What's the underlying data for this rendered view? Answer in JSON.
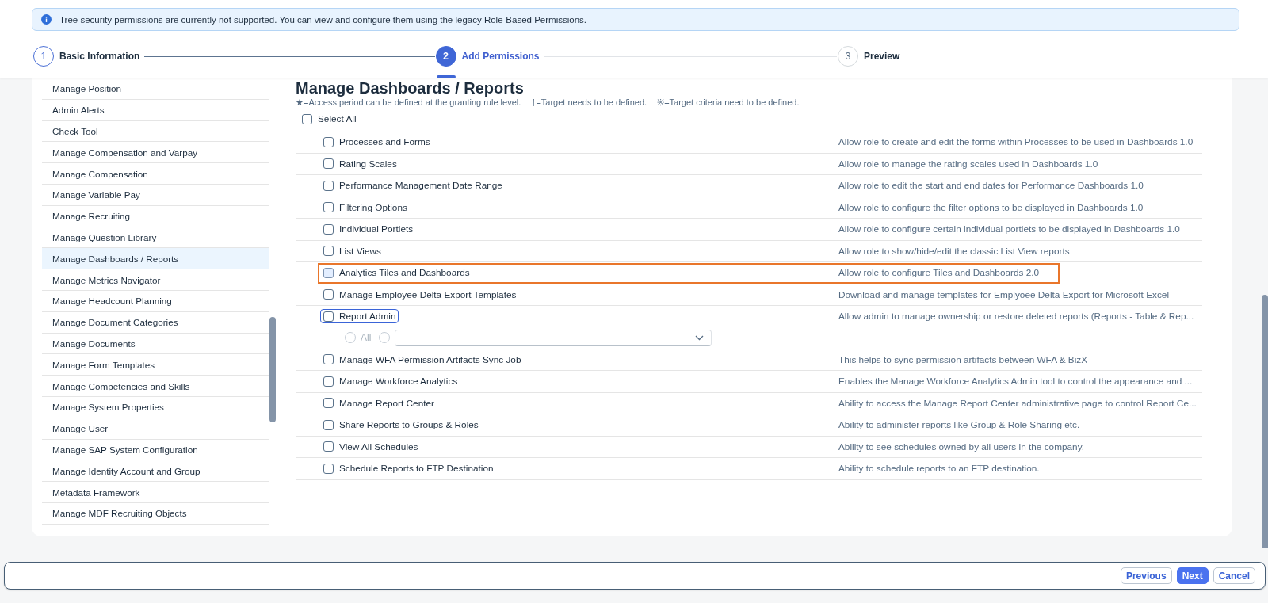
{
  "banner": {
    "kind": "info",
    "text": "Tree security permissions are currently not supported. You can view and configure them using the legacy Role-Based Permissions."
  },
  "steps": [
    {
      "number": "1",
      "label": "Basic Information",
      "selected": false,
      "completed": true
    },
    {
      "number": "2",
      "label": "Add Permissions",
      "selected": true,
      "completed": false
    },
    {
      "number": "3",
      "label": "Preview",
      "selected": false,
      "completed": false
    }
  ],
  "sidebar": {
    "items": [
      {
        "label": "Manage Position",
        "selected": false
      },
      {
        "label": "Admin Alerts",
        "selected": false
      },
      {
        "label": "Check Tool",
        "selected": false
      },
      {
        "label": "Manage Compensation and Varpay",
        "selected": false
      },
      {
        "label": "Manage Compensation",
        "selected": false
      },
      {
        "label": "Manage Variable Pay",
        "selected": false
      },
      {
        "label": "Manage Recruiting",
        "selected": false
      },
      {
        "label": "Manage Question Library",
        "selected": false
      },
      {
        "label": "Manage Dashboards / Reports",
        "selected": true
      },
      {
        "label": "Manage Metrics Navigator",
        "selected": false
      },
      {
        "label": "Manage Headcount Planning",
        "selected": false
      },
      {
        "label": "Manage Document Categories",
        "selected": false
      },
      {
        "label": "Manage Documents",
        "selected": false
      },
      {
        "label": "Manage Form Templates",
        "selected": false
      },
      {
        "label": "Manage Competencies and Skills",
        "selected": false
      },
      {
        "label": "Manage System Properties",
        "selected": false
      },
      {
        "label": "Manage User",
        "selected": false
      },
      {
        "label": "Manage SAP System Configuration",
        "selected": false
      },
      {
        "label": "Manage Identity Account and Group",
        "selected": false
      },
      {
        "label": "Metadata Framework",
        "selected": false
      },
      {
        "label": "Manage MDF Recruiting Objects",
        "selected": false
      }
    ]
  },
  "section": {
    "title": "Manage Dashboards / Reports",
    "legend": [
      "★=Access period can be defined at the granting rule level.",
      "†=Target needs to be defined.",
      "※=Target criteria need to be defined."
    ],
    "select_all": {
      "label": "Select All",
      "checked": false
    },
    "permissions": [
      {
        "label": "Processes and Forms",
        "description": "Allow role to create and edit the forms within Processes to be used in Dashboards 1.0",
        "checked": false,
        "hovered": false,
        "focused": false,
        "highlighted": false
      },
      {
        "label": "Rating Scales",
        "description": "Allow role to manage the rating scales used in Dashboards 1.0",
        "checked": false,
        "hovered": false,
        "focused": false,
        "highlighted": false
      },
      {
        "label": "Performance Management Date Range",
        "description": "Allow role to edit the start and end dates for Performance Dashboards 1.0",
        "checked": false,
        "hovered": false,
        "focused": false,
        "highlighted": false
      },
      {
        "label": "Filtering Options",
        "description": "Allow role to configure the filter options to be displayed in Dashboards 1.0",
        "checked": false,
        "hovered": false,
        "focused": false,
        "highlighted": false
      },
      {
        "label": "Individual Portlets",
        "description": "Allow role to configure certain individual portlets to be displayed in Dashboards 1.0",
        "checked": false,
        "hovered": false,
        "focused": false,
        "highlighted": false
      },
      {
        "label": "List Views",
        "description": "Allow role to show/hide/edit the classic List View reports",
        "checked": false,
        "hovered": false,
        "focused": false,
        "highlighted": false
      },
      {
        "label": "Analytics Tiles and Dashboards",
        "description": "Allow role to configure Tiles and Dashboards 2.0",
        "checked": false,
        "hovered": true,
        "focused": false,
        "highlighted": true
      },
      {
        "label": "Manage Employee Delta Export Templates",
        "description": "Download and manage templates for Emplyoee Delta Export for Microsoft Excel",
        "checked": false,
        "hovered": false,
        "focused": false,
        "highlighted": false
      },
      {
        "label": "Report Admin",
        "description": "Allow admin to manage ownership or restore deleted reports (Reports - Table & Rep...",
        "checked": false,
        "hovered": false,
        "focused": true,
        "highlighted": false,
        "scope_options": [
          {
            "kind": "radio",
            "label": "All",
            "selected": false,
            "disabled": true
          },
          {
            "kind": "radio-select",
            "selected": false,
            "disabled": true
          }
        ]
      },
      {
        "label": "Manage WFA Permission Artifacts Sync Job",
        "description": "This helps to sync permission artifacts between WFA & BizX",
        "checked": false,
        "hovered": false,
        "focused": false,
        "highlighted": false
      },
      {
        "label": "Manage Workforce Analytics",
        "description": "Enables the Manage Workforce Analytics Admin tool to control the appearance and ...",
        "checked": false,
        "hovered": false,
        "focused": false,
        "highlighted": false
      },
      {
        "label": "Manage Report Center",
        "description": "Ability to access the Manage Report Center administrative page to control Report Ce...",
        "checked": false,
        "hovered": false,
        "focused": false,
        "highlighted": false
      },
      {
        "label": "Share Reports to Groups & Roles",
        "description": "Ability to administer reports like Group & Role Sharing etc.",
        "checked": false,
        "hovered": false,
        "focused": false,
        "highlighted": false
      },
      {
        "label": "View All Schedules",
        "description": "Ability to see schedules owned by all users in the company.",
        "checked": false,
        "hovered": false,
        "focused": false,
        "highlighted": false
      },
      {
        "label": "Schedule Reports to FTP Destination",
        "description": "Ability to schedule reports to an FTP destination.",
        "checked": false,
        "hovered": false,
        "focused": false,
        "highlighted": false
      }
    ]
  },
  "footer": {
    "buttons": [
      {
        "label": "Previous",
        "kind": "secondary"
      },
      {
        "label": "Next",
        "kind": "primary"
      },
      {
        "label": "Cancel",
        "kind": "secondary"
      }
    ]
  }
}
